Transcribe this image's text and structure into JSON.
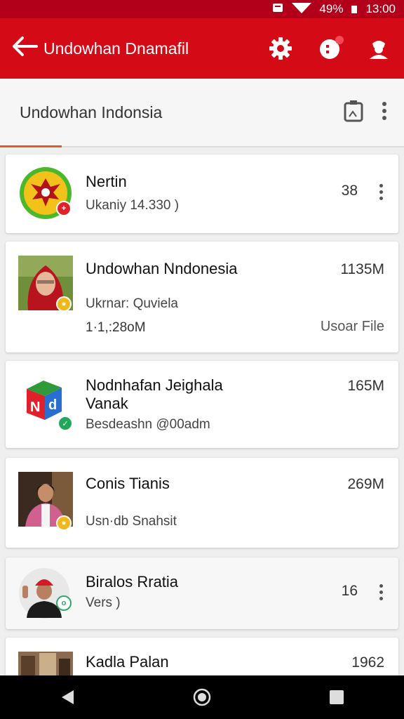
{
  "status_bar": {
    "battery_percent": "49%",
    "time": "13:00",
    "icons": [
      "notification-icon",
      "wifi-icon",
      "battery-icon"
    ]
  },
  "app_bar": {
    "title": "Undowhan Dnamafil",
    "icons": [
      "back-arrow-icon",
      "gear-icon",
      "notifications-icon",
      "profile-icon"
    ],
    "accent": "#d40a17"
  },
  "sub_bar": {
    "title": "Undowhan Indonsia",
    "icons": [
      "calendar-icon",
      "more-vert-icon"
    ]
  },
  "items": [
    {
      "name": "Nertin",
      "sub": "Ukaniy 14.330 )",
      "size": "38",
      "has_menu": true
    },
    {
      "name": "Undowhan Nndonesia",
      "sub": "Ukrnar: Quviela",
      "meta": "1·1,:28oM",
      "size": "1135M",
      "source": "Usoar File"
    },
    {
      "name": "Nodnhafan Jeighala",
      "name2": "Vanak",
      "sub": "Besdeashn @00adm",
      "size": "165M"
    },
    {
      "name": "Conis Tianis",
      "sub": "Usn·db Snahsit",
      "size": "269M"
    },
    {
      "name": "Biralos Rratia",
      "sub": "Vers )",
      "size": "16",
      "has_menu": true
    },
    {
      "name": "Kadla Palan",
      "size": "1962"
    }
  ],
  "nav_bar": {
    "icons": [
      "back-nav-icon",
      "home-nav-icon",
      "recents-nav-icon"
    ]
  }
}
